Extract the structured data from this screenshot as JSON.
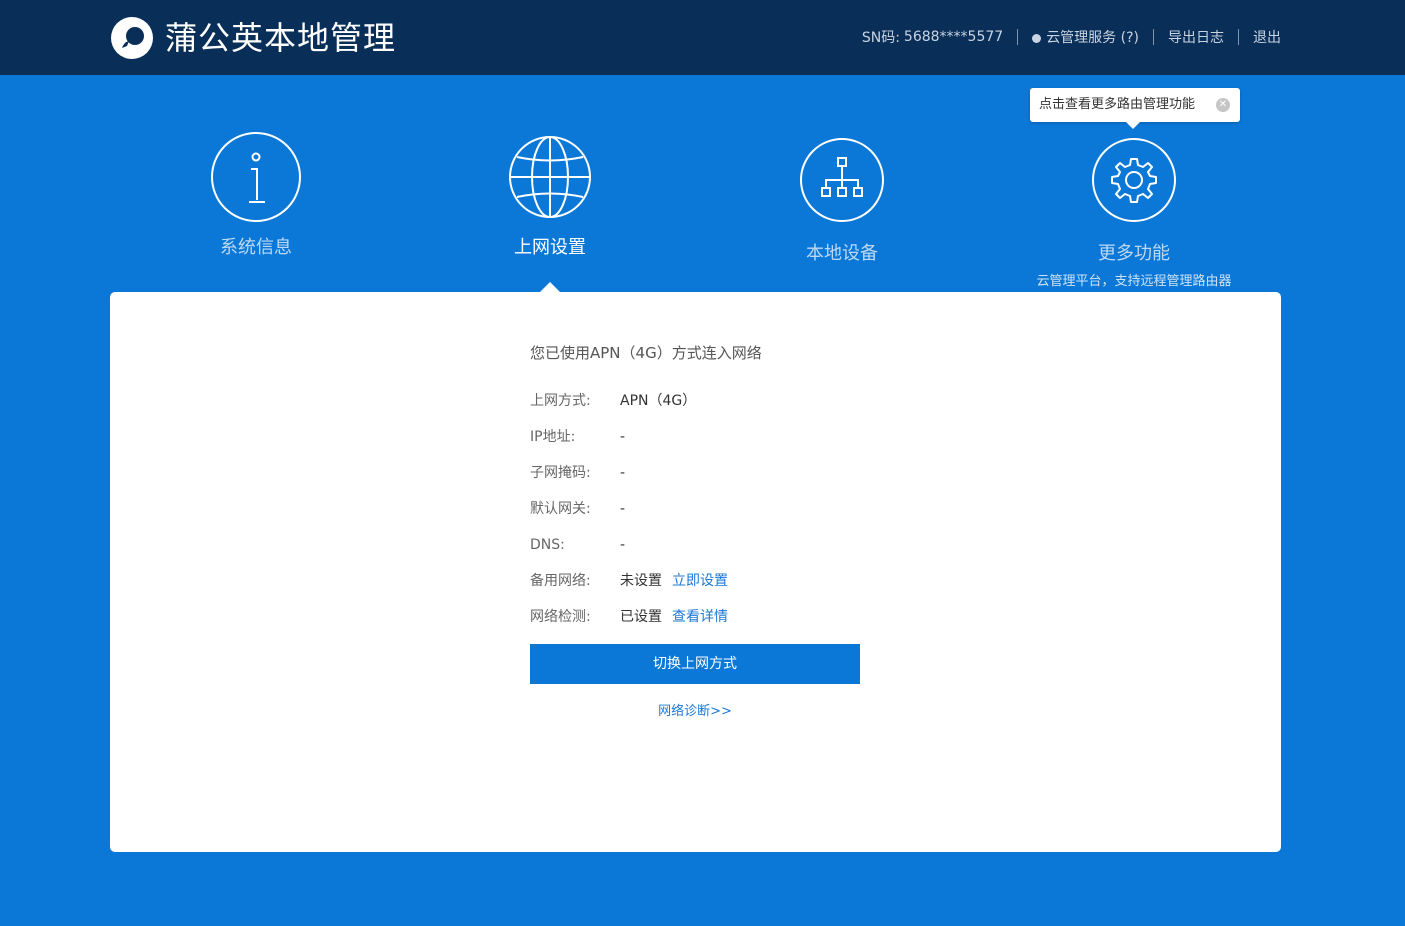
{
  "header": {
    "brand": "蒲公英本地管理",
    "sn_label": "SN码:",
    "sn_value": "5688****5577",
    "cloud_service": "云管理服务 (?)",
    "export_log": "导出日志",
    "logout": "退出",
    "logo_icon": "dandelion-logo-icon"
  },
  "nav": {
    "items": [
      {
        "label": "系统信息",
        "icon": "info-icon"
      },
      {
        "label": "上网设置",
        "icon": "globe-icon",
        "active": true
      },
      {
        "label": "本地设备",
        "icon": "network-tree-icon"
      },
      {
        "label": "更多功能",
        "icon": "gear-icon",
        "subtitle": "云管理平台，支持远程管理路由器"
      }
    ]
  },
  "tooltip": {
    "text": "点击查看更多路由管理功能",
    "close_icon": "close-circle-icon"
  },
  "panel": {
    "headline": "您已使用APN（4G）方式连入网络",
    "rows": [
      {
        "label": "上网方式:",
        "value": "APN（4G）"
      },
      {
        "label": "IP地址:",
        "value": "-"
      },
      {
        "label": "子网掩码:",
        "value": "-"
      },
      {
        "label": "默认网关:",
        "value": "-"
      },
      {
        "label": "DNS:",
        "value": "-"
      },
      {
        "label": "备用网络:",
        "value": "未设置",
        "action": "立即设置"
      },
      {
        "label": "网络检测:",
        "value": "已设置",
        "action": "查看详情"
      }
    ],
    "switch_button": "切换上网方式",
    "diagnose_link": "网络诊断>>"
  },
  "colors": {
    "background": "#0b78d8",
    "header": "#092e58",
    "accent": "#1a78d6",
    "panel": "#ffffff"
  }
}
